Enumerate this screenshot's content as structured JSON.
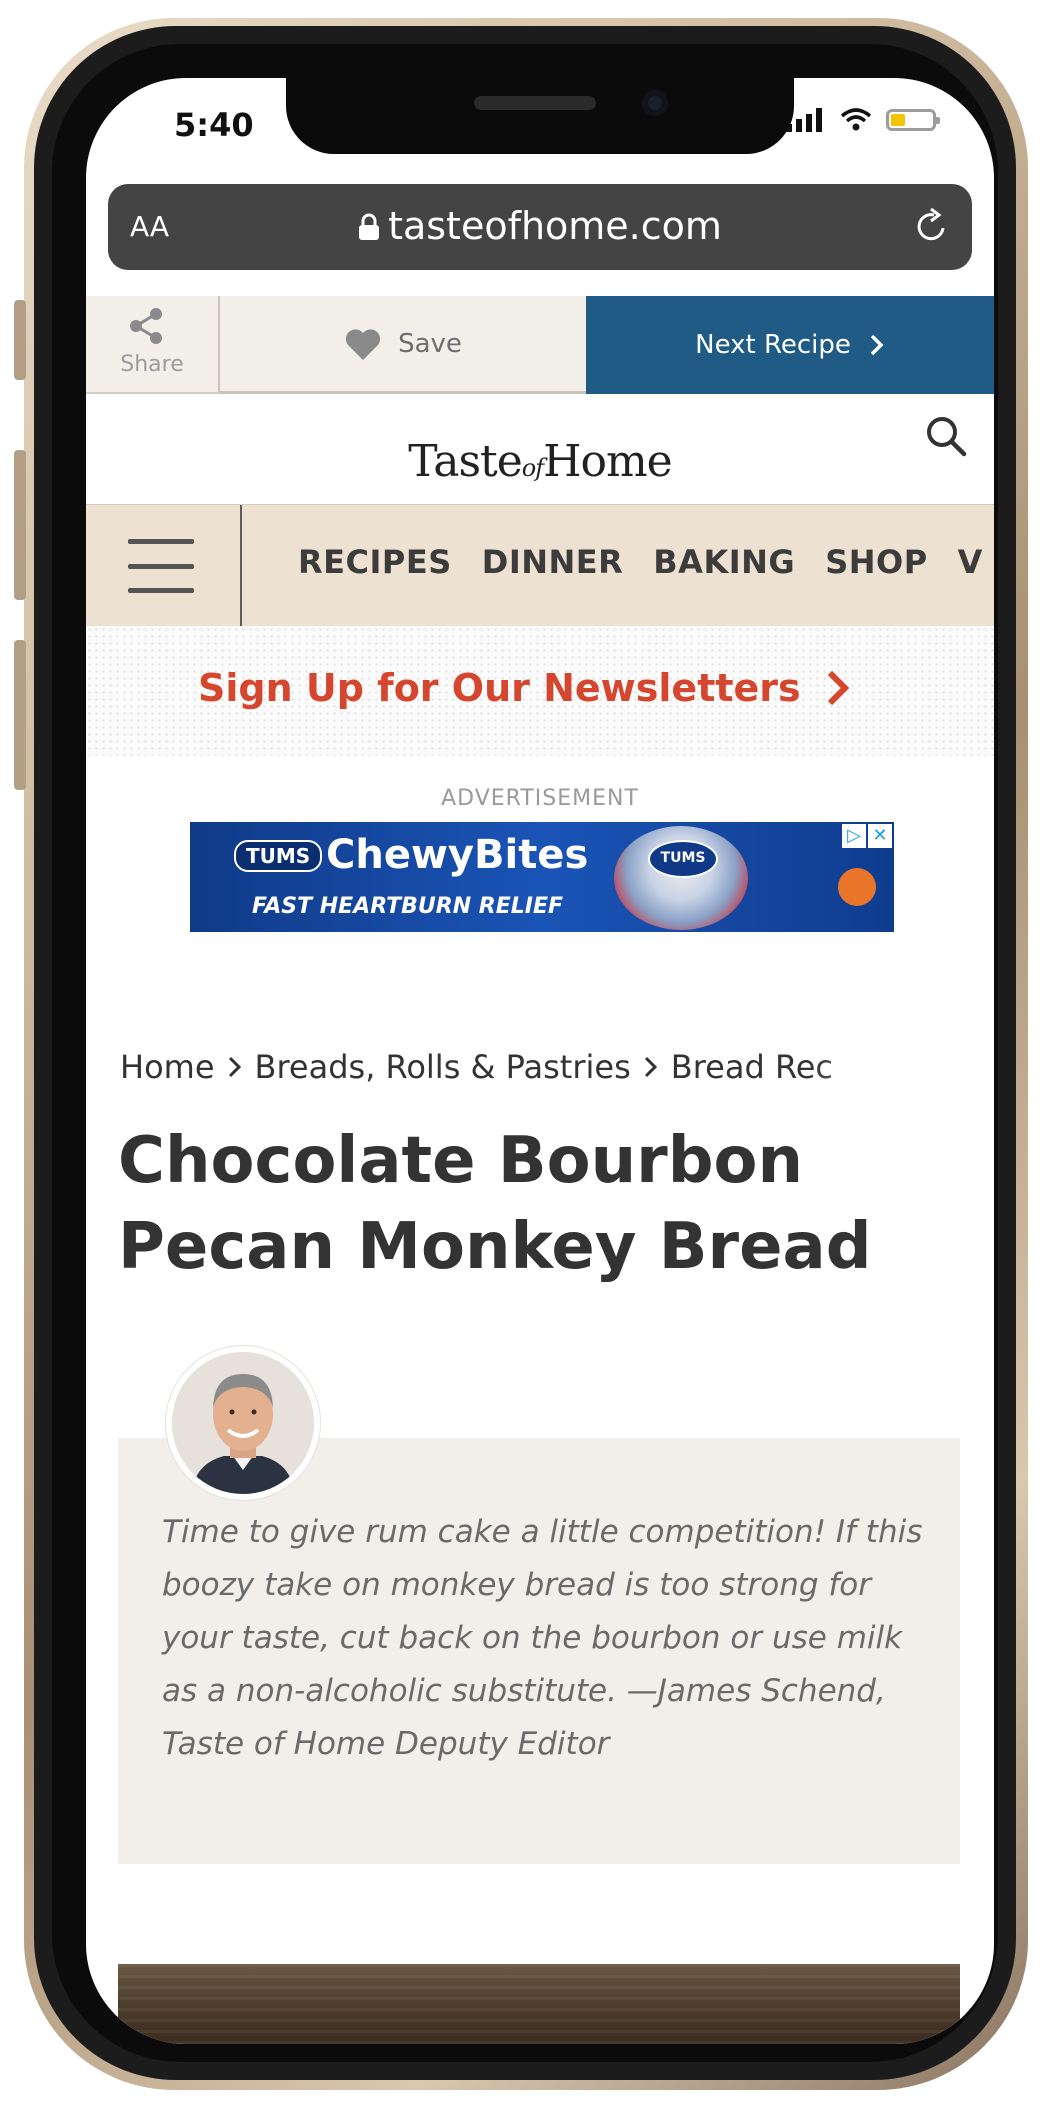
{
  "status_bar": {
    "time": "5:40"
  },
  "browser": {
    "text_size_label": "AA",
    "domain": "tasteofhome.com"
  },
  "action_bar": {
    "share_label": "Share",
    "save_label": "Save",
    "next_label": "Next Recipe"
  },
  "header": {
    "logo_part1": "Taste",
    "logo_of": "of",
    "logo_part2": "Home"
  },
  "nav": {
    "items": [
      "RECIPES",
      "DINNER",
      "BAKING",
      "SHOP",
      "V"
    ]
  },
  "newsletter": {
    "label": "Sign Up for Our Newsletters"
  },
  "ad": {
    "label": "ADVERTISEMENT",
    "brand_badge": "TUMS",
    "product": "ChewyBites",
    "tagline": "FAST HEARTBURN RELIEF",
    "jar_label": "TUMS"
  },
  "breadcrumb": [
    "Home",
    "Breads, Rolls & Pastries",
    "Bread Rec"
  ],
  "recipe": {
    "title": "Chocolate Bourbon Pecan Monkey Bread",
    "intro": "Time to give rum cake a little competition! If this boozy take on monkey bread is too strong for your taste, cut back on the bourbon or use milk as a non-alcoholic substitute. —James Schend, Taste of Home Deputy Editor"
  },
  "colors": {
    "next_button": "#205b85",
    "nav_background": "#ede1d1",
    "newsletter_text": "#d4462e",
    "intro_background": "#f2efea"
  },
  "icons": {
    "share": "share-icon",
    "save": "heart-icon",
    "next": "chevron-right-icon",
    "search": "search-icon",
    "menu": "hamburger-menu-icon",
    "reload": "reload-icon",
    "lock": "lock-icon"
  }
}
